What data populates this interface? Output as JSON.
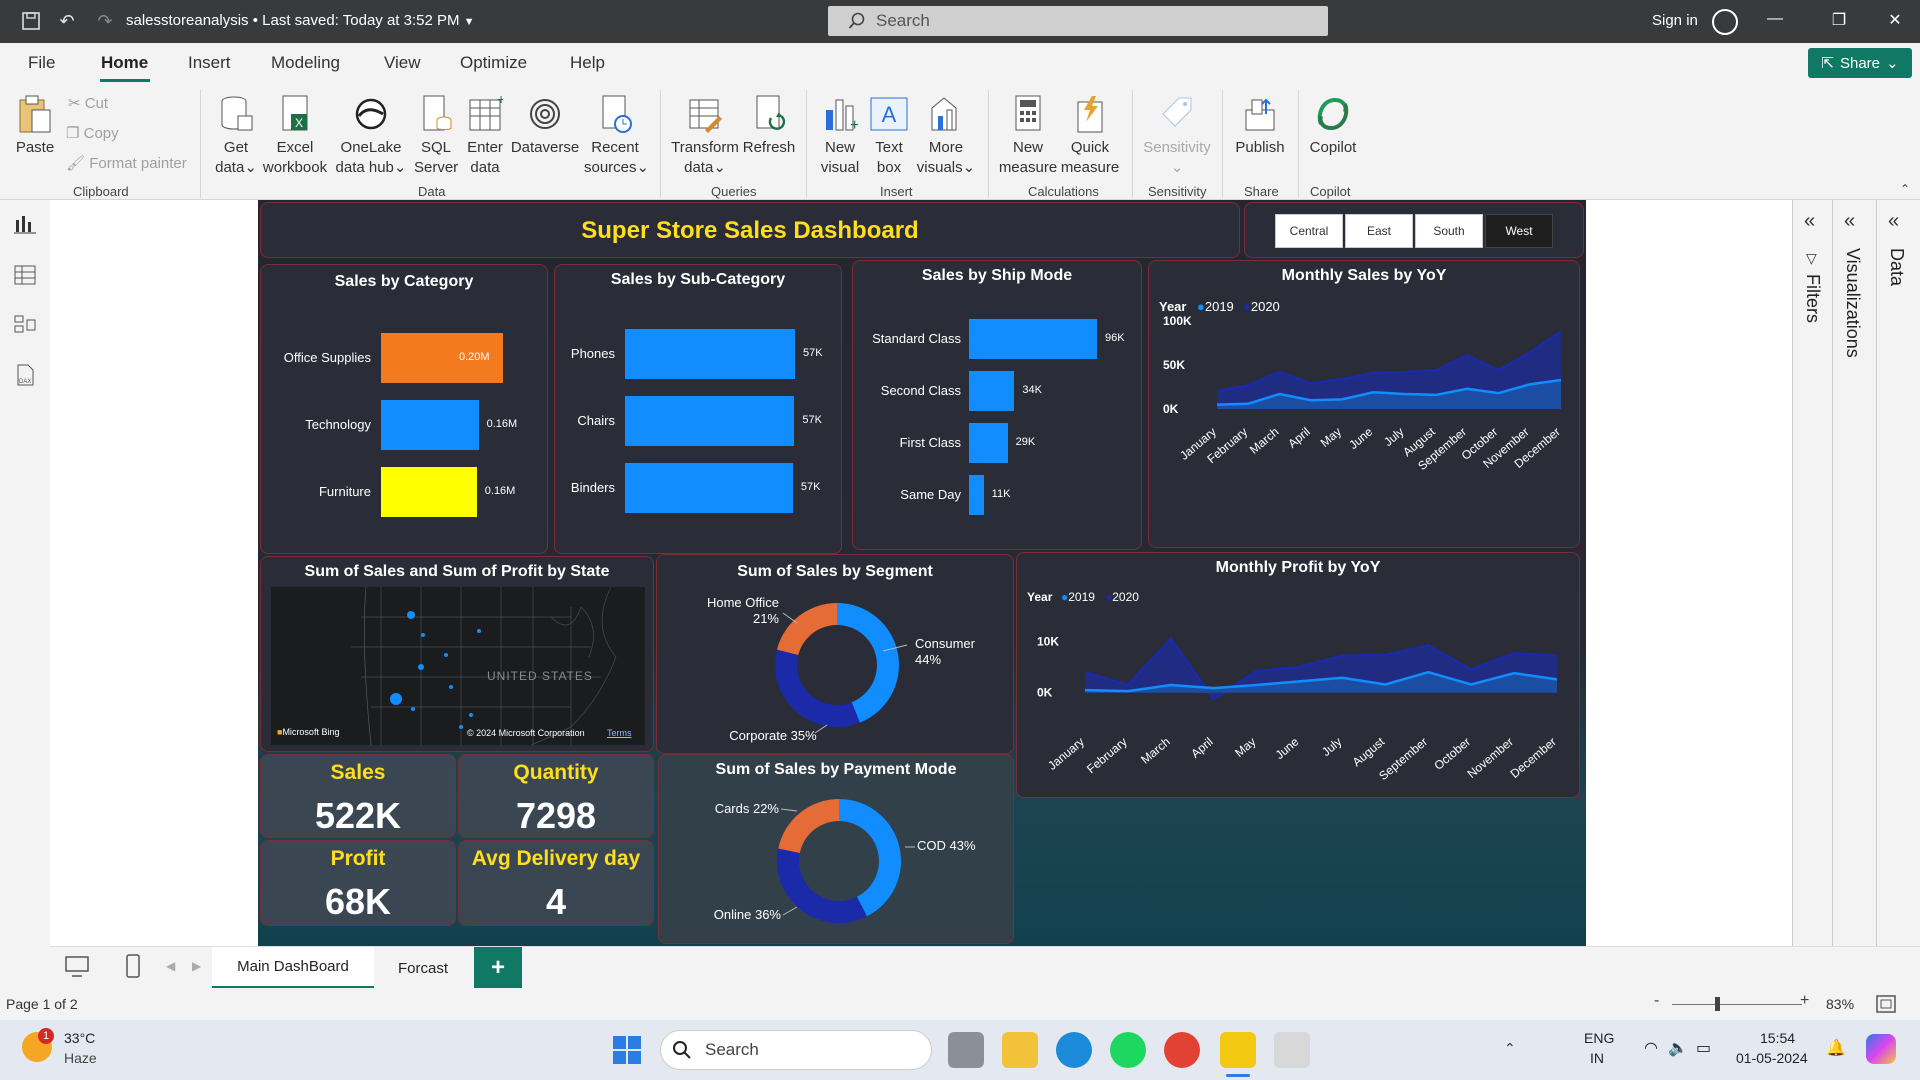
{
  "titlebar": {
    "filename": "salesstoreanalysis",
    "saved": "Last saved: Today at 3:52 PM",
    "search_placeholder": "Search",
    "signin": "Sign in"
  },
  "menu": {
    "items": [
      "File",
      "Home",
      "Insert",
      "Modeling",
      "View",
      "Optimize",
      "Help"
    ],
    "share": "Share"
  },
  "ribbon": {
    "paste": "Paste",
    "cut": "Cut",
    "copy": "Copy",
    "format_painter": "Format painter",
    "get_data": [
      "Get",
      "data"
    ],
    "excel": [
      "Excel",
      "workbook"
    ],
    "onelake": [
      "OneLake",
      "data hub"
    ],
    "sql": [
      "SQL",
      "Server"
    ],
    "enter": [
      "Enter",
      "data"
    ],
    "dataverse": "Dataverse",
    "recent": [
      "Recent",
      "sources"
    ],
    "transform": [
      "Transform",
      "data"
    ],
    "refresh": "Refresh",
    "new_visual": [
      "New",
      "visual"
    ],
    "text_box": [
      "Text",
      "box"
    ],
    "more_visuals": [
      "More",
      "visuals"
    ],
    "new_measure": [
      "New",
      "measure"
    ],
    "quick_measure": [
      "Quick",
      "measure"
    ],
    "sensitivity": "Sensitivity",
    "publish": "Publish",
    "copilot": "Copilot",
    "groups": [
      "Clipboard",
      "Data",
      "Queries",
      "Insert",
      "Calculations",
      "Sensitivity",
      "Share",
      "Copilot"
    ]
  },
  "dashboard": {
    "title": "Super Store Sales Dashboard",
    "slicers": [
      "Central",
      "East",
      "South",
      "West"
    ],
    "selected_slicer": "West",
    "category": {
      "title": "Sales by Category",
      "items": [
        {
          "label": "Office Supplies",
          "value": "0.20M",
          "num": 0.2,
          "color": "#f47a1f"
        },
        {
          "label": "Technology",
          "value": "0.16M",
          "num": 0.16,
          "color": "#118dff"
        },
        {
          "label": "Furniture",
          "value": "0.16M",
          "num": 0.157,
          "color": "#ffff00"
        }
      ]
    },
    "subcategory": {
      "title": "Sales by Sub-Category",
      "items": [
        {
          "label": "Phones",
          "value": "57K",
          "num": 57
        },
        {
          "label": "Chairs",
          "value": "57K",
          "num": 56.8
        },
        {
          "label": "Binders",
          "value": "57K",
          "num": 56.3
        }
      ]
    },
    "shipmode": {
      "title": "Sales by Ship Mode",
      "items": [
        {
          "label": "Standard Class",
          "value": "96K",
          "num": 96
        },
        {
          "label": "Second Class",
          "value": "34K",
          "num": 34
        },
        {
          "label": "First Class",
          "value": "29K",
          "num": 29
        },
        {
          "label": "Same Day",
          "value": "11K",
          "num": 11
        }
      ]
    },
    "monthly_sales": {
      "title": "Monthly Sales by YoY",
      "legend_title": "Year",
      "series": [
        "2019",
        "2020"
      ],
      "yticks": [
        "100K",
        "50K",
        "0K"
      ]
    },
    "monthly_profit": {
      "title": "Monthly Profit by YoY",
      "legend_title": "Year",
      "series": [
        "2019",
        "2020"
      ],
      "yticks": [
        "10K",
        "0K"
      ]
    },
    "months": [
      "January",
      "February",
      "March",
      "April",
      "May",
      "June",
      "July",
      "August",
      "September",
      "October",
      "November",
      "December"
    ],
    "map": {
      "title": "Sum of Sales and Sum of Profit by State",
      "label": "UNITED STATES",
      "bing": "Microsoft Bing",
      "copyright": "© 2024 Microsoft Corporation",
      "terms": "Terms"
    },
    "segment": {
      "title": "Sum of Sales by Segment",
      "slices": [
        {
          "label": "Consumer",
          "pct": "44%",
          "value": 44,
          "color": "#118dff"
        },
        {
          "label": "Corporate",
          "pct": "35%",
          "value": 35,
          "color": "#1a2aa8"
        },
        {
          "label": "Home Office",
          "pct": "21%",
          "value": 21,
          "color": "#e66c37"
        }
      ]
    },
    "payment": {
      "title": "Sum of Sales by Payment Mode",
      "slices": [
        {
          "label": "COD",
          "pct": "43%",
          "value": 43,
          "color": "#118dff"
        },
        {
          "label": "Online",
          "pct": "36%",
          "value": 36,
          "color": "#1a2aa8"
        },
        {
          "label": "Cards",
          "pct": "22%",
          "value": 22,
          "color": "#e66c37"
        }
      ]
    },
    "kpis": [
      {
        "title": "Sales",
        "value": "522K"
      },
      {
        "title": "Quantity",
        "value": "7298"
      },
      {
        "title": "Profit",
        "value": "68K"
      },
      {
        "title": "Avg Delivery day",
        "value": "4"
      }
    ]
  },
  "chart_data": [
    {
      "type": "bar",
      "title": "Sales by Category",
      "categories": [
        "Office Supplies",
        "Technology",
        "Furniture"
      ],
      "values": [
        0.2,
        0.16,
        0.157
      ]
    },
    {
      "type": "bar",
      "title": "Sales by Sub-Category",
      "categories": [
        "Phones",
        "Chairs",
        "Binders"
      ],
      "values": [
        57,
        56.8,
        56.3
      ]
    },
    {
      "type": "bar",
      "title": "Sales by Ship Mode",
      "categories": [
        "Standard Class",
        "Second Class",
        "First Class",
        "Same Day"
      ],
      "values": [
        96,
        34,
        29,
        11
      ]
    },
    {
      "type": "area",
      "title": "Monthly Sales by YoY",
      "x": [
        "January",
        "February",
        "March",
        "April",
        "May",
        "June",
        "July",
        "August",
        "September",
        "October",
        "November",
        "December"
      ],
      "series": [
        {
          "name": "2019",
          "values": [
            5,
            6,
            17,
            10,
            11,
            19,
            17,
            16,
            23,
            18,
            28,
            33
          ]
        },
        {
          "name": "2020",
          "values": [
            20,
            27,
            42,
            29,
            34,
            41,
            42,
            44,
            61,
            44,
            64,
            88
          ]
        }
      ],
      "ylim": [
        0,
        100
      ]
    },
    {
      "type": "area",
      "title": "Monthly Profit by YoY",
      "x": [
        "January",
        "February",
        "March",
        "April",
        "May",
        "June",
        "July",
        "August",
        "September",
        "October",
        "November",
        "December"
      ],
      "series": [
        {
          "name": "2019",
          "values": [
            0.5,
            0.3,
            1.5,
            0.9,
            1.5,
            2.2,
            2.9,
            1.6,
            4.0,
            1.6,
            3.8,
            2.6
          ]
        },
        {
          "name": "2020",
          "values": [
            4.0,
            1.5,
            10.5,
            -1.3,
            4.2,
            5.0,
            7.2,
            7.3,
            9.2,
            4.5,
            7.7,
            7.2
          ]
        }
      ],
      "ylim": [
        -2,
        12
      ]
    },
    {
      "type": "pie",
      "title": "Sum of Sales by Segment",
      "categories": [
        "Consumer",
        "Corporate",
        "Home Office"
      ],
      "values": [
        44,
        35,
        21
      ]
    },
    {
      "type": "pie",
      "title": "Sum of Sales by Payment Mode",
      "categories": [
        "COD",
        "Online",
        "Cards"
      ],
      "values": [
        43,
        36,
        22
      ]
    }
  ],
  "tabs": {
    "pages": [
      "Main DashBoard",
      "Forcast"
    ],
    "add": "+"
  },
  "panes": {
    "filters": "Filters",
    "visualizations": "Visualizations",
    "data": "Data"
  },
  "status": {
    "page": "Page 1 of 2",
    "zoom": "83%"
  },
  "taskbar": {
    "temp": "33°C",
    "weather": "Haze",
    "search": "Search",
    "lang1": "ENG",
    "lang2": "IN",
    "time": "15:54",
    "date": "01-05-2024",
    "badge": "1"
  },
  "colors": {
    "accent": "#117865",
    "title_yellow": "#ffde1e",
    "bar_blue": "#118dff",
    "dark_blue": "#1a2aa8"
  }
}
